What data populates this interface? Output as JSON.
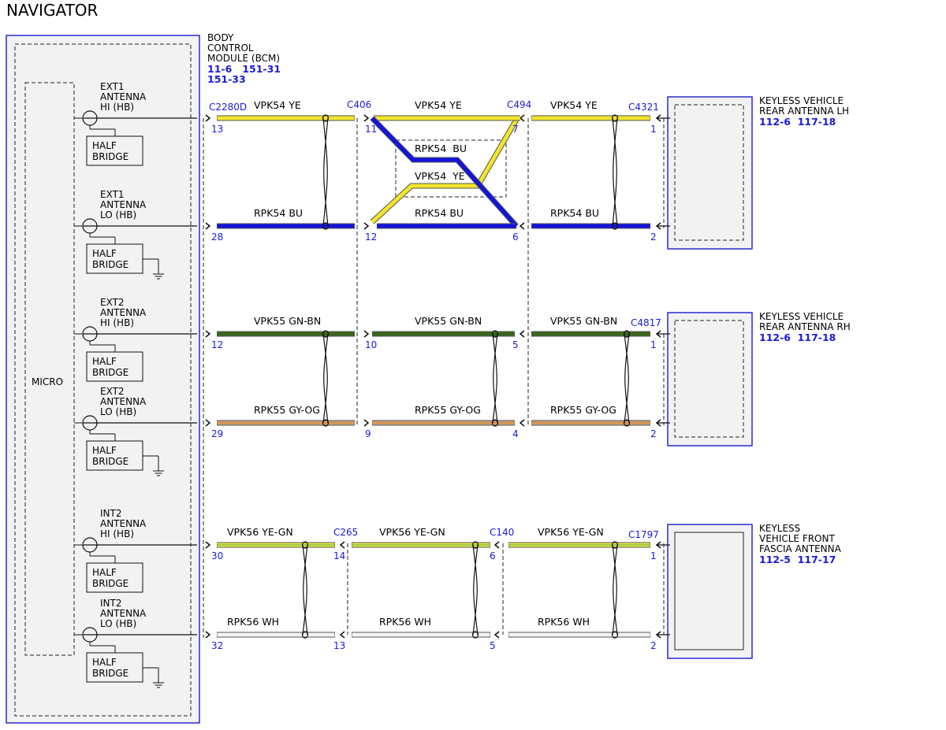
{
  "title": "NAVIGATOR",
  "colors": {
    "YE": "#f2e52a",
    "BU": "#1414dc",
    "GN-BN": "#2e6e1e",
    "GY-OG": "#c9a27a",
    "YE-GN": "#e9ec4a",
    "WH": "#f4f4f4",
    "ref_blue": "#1a1adc",
    "module_border": "#2a2ad0"
  },
  "bcm": {
    "name_lines": [
      "BODY",
      "CONTROL",
      "MODULE (BCM)"
    ],
    "refs": [
      "11-6   151-31",
      "151-33"
    ],
    "micro_label": "MICRO",
    "half_bridge_lines": [
      "HALF",
      "BRIDGE"
    ],
    "antennas": [
      {
        "lines": [
          "EXT1",
          "ANTENNA",
          "HI (HB)"
        ]
      },
      {
        "lines": [
          "EXT1",
          "ANTENNA",
          "LO (HB)"
        ]
      },
      {
        "lines": [
          "EXT2",
          "ANTENNA",
          "HI (HB)"
        ]
      },
      {
        "lines": [
          "EXT2",
          "ANTENNA",
          "LO (HB)"
        ]
      },
      {
        "lines": [
          "INT2",
          "ANTENNA",
          "HI (HB)"
        ]
      },
      {
        "lines": [
          "INT2",
          "ANTENNA",
          "LO (HB)"
        ]
      }
    ]
  },
  "connectors": [
    "C2280D",
    "C406",
    "C494",
    "C4321",
    "C4817",
    "C265",
    "C140",
    "C1797"
  ],
  "devices": [
    {
      "name_lines": [
        "KEYLESS VEHICLE",
        "REAR ANTENNA LH"
      ],
      "refs": "112-6  117-18"
    },
    {
      "name_lines": [
        "KEYLESS VEHICLE",
        "REAR ANTENNA RH"
      ],
      "refs": "112-6  117-18"
    },
    {
      "name_lines": [
        "KEYLESS",
        "VEHICLE FRONT",
        "FASCIA ANTENNA"
      ],
      "refs": "112-5  117-17"
    }
  ],
  "circuits": [
    {
      "segments": [
        {
          "circuit": "VPK54",
          "color": "YE"
        },
        {
          "circuit": "VPK54",
          "color": "YE"
        },
        {
          "circuit": "VPK54",
          "color": "YE"
        }
      ],
      "pins": [
        "13",
        "11",
        "7",
        "1"
      ]
    },
    {
      "segments": [
        {
          "circuit": "RPK54",
          "color": "BU"
        },
        {
          "circuit": "RPK54",
          "color": "BU"
        },
        {
          "circuit": "RPK54",
          "color": "BU"
        }
      ],
      "pins": [
        "28",
        "12",
        "6",
        "2"
      ]
    },
    {
      "segments": [
        {
          "circuit": "VPK55",
          "color": "GN-BN"
        },
        {
          "circuit": "VPK55",
          "color": "GN-BN"
        },
        {
          "circuit": "VPK55",
          "color": "GN-BN"
        }
      ],
      "pins": [
        "12",
        "10",
        "5",
        "1"
      ]
    },
    {
      "segments": [
        {
          "circuit": "RPK55",
          "color": "GY-OG"
        },
        {
          "circuit": "RPK55",
          "color": "GY-OG"
        },
        {
          "circuit": "RPK55",
          "color": "GY-OG"
        }
      ],
      "pins": [
        "29",
        "9",
        "4",
        "2"
      ]
    },
    {
      "segments": [
        {
          "circuit": "VPK56",
          "color": "YE-GN"
        },
        {
          "circuit": "VPK56",
          "color": "YE-GN"
        },
        {
          "circuit": "VPK56",
          "color": "YE-GN"
        }
      ],
      "pins": [
        "30",
        "14",
        "6",
        "1"
      ]
    },
    {
      "segments": [
        {
          "circuit": "RPK56",
          "color": "WH"
        },
        {
          "circuit": "RPK56",
          "color": "WH"
        },
        {
          "circuit": "RPK56",
          "color": "WH"
        }
      ],
      "pins": [
        "32",
        "13",
        "5",
        "2"
      ]
    }
  ],
  "crossover": {
    "upper": {
      "circuit": "RPK54",
      "color": "BU"
    },
    "lower": {
      "circuit": "VPK54",
      "color": "YE"
    }
  }
}
